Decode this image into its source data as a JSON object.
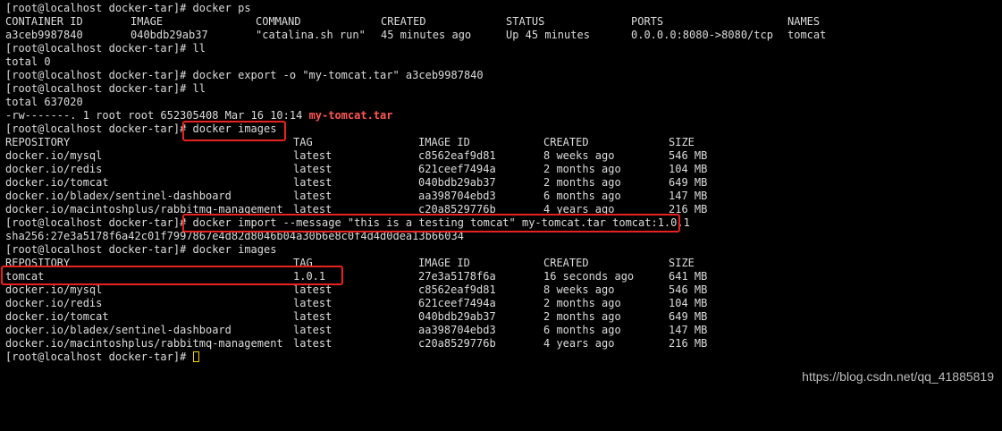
{
  "prompt": "[root@localhost docker-tar]# ",
  "commands": {
    "ps": "docker ps",
    "ll": "ll",
    "export": "docker export -o \"my-tomcat.tar\" a3ceb9987840",
    "images": "docker images",
    "import": "docker import --message \"this is a testing tomcat\" my-tomcat.tar tomcat:1.0.1"
  },
  "ps_table": {
    "headers": [
      "CONTAINER ID",
      "IMAGE",
      "COMMAND",
      "CREATED",
      "STATUS",
      "PORTS",
      "NAMES"
    ],
    "row": [
      "a3ceb9987840",
      "040bdb29ab37",
      "\"catalina.sh run\"",
      "45 minutes ago",
      "Up 45 minutes",
      "0.0.0.0:8080->8080/tcp",
      "tomcat"
    ]
  },
  "ll_output": {
    "total_before": "total 0",
    "total_after": "total 637020",
    "file_meta": "-rw-------. 1 root root 652305408 Mar 16 10:14 ",
    "file_name": "my-tomcat.tar"
  },
  "images_headers": [
    "REPOSITORY",
    "TAG",
    "IMAGE ID",
    "CREATED",
    "SIZE"
  ],
  "images_before": [
    [
      "docker.io/mysql",
      "latest",
      "c8562eaf9d81",
      "8 weeks ago",
      "546 MB"
    ],
    [
      "docker.io/redis",
      "latest",
      "621ceef7494a",
      "2 months ago",
      "104 MB"
    ],
    [
      "docker.io/tomcat",
      "latest",
      "040bdb29ab37",
      "2 months ago",
      "649 MB"
    ],
    [
      "docker.io/bladex/sentinel-dashboard",
      "latest",
      "aa398704ebd3",
      "6 months ago",
      "147 MB"
    ],
    [
      "docker.io/macintoshplus/rabbitmq-management",
      "latest",
      "c20a8529776b",
      "4 years ago",
      "216 MB"
    ]
  ],
  "import_sha": "sha256:27e3a5178f6a42c01f7997867e4d82d8046b04a30b6e8c0f4d4d0dea13b66034",
  "images_after": [
    [
      "tomcat",
      "1.0.1",
      "27e3a5178f6a",
      "16 seconds ago",
      "641 MB"
    ],
    [
      "docker.io/mysql",
      "latest",
      "c8562eaf9d81",
      "8 weeks ago",
      "546 MB"
    ],
    [
      "docker.io/redis",
      "latest",
      "621ceef7494a",
      "2 months ago",
      "104 MB"
    ],
    [
      "docker.io/tomcat",
      "latest",
      "040bdb29ab37",
      "2 months ago",
      "649 MB"
    ],
    [
      "docker.io/bladex/sentinel-dashboard",
      "latest",
      "aa398704ebd3",
      "6 months ago",
      "147 MB"
    ],
    [
      "docker.io/macintoshplus/rabbitmq-management",
      "latest",
      "c20a8529776b",
      "4 years ago",
      "216 MB"
    ]
  ],
  "watermark": "https://blog.csdn.net/qq_41885819",
  "colors": {
    "background": "#000000",
    "text": "#dcdcdc",
    "filename": "#ff5555",
    "highlight": "#e8231f",
    "cursor": "#f5d20a"
  }
}
